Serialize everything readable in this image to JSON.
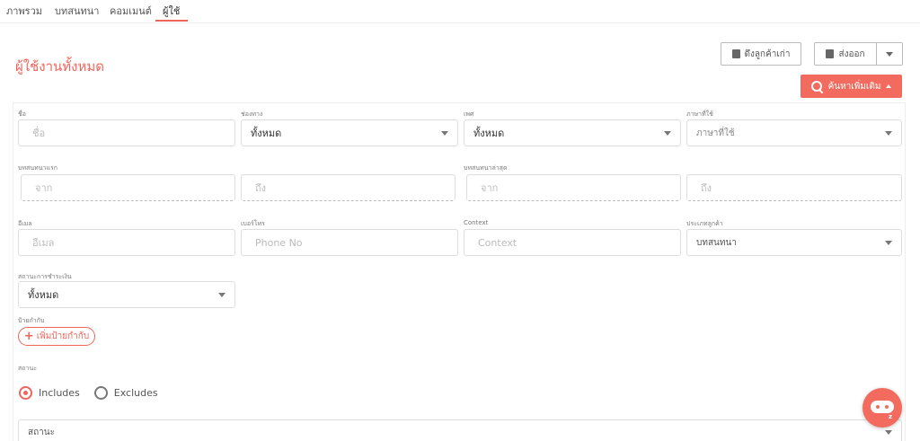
{
  "tabs": [
    {
      "label": "ภาพรวม",
      "active": false
    },
    {
      "label": "บทสนทนา",
      "active": false
    },
    {
      "label": "คอมเมนต์",
      "active": false
    },
    {
      "label": "ผู้ใช้",
      "active": true
    }
  ],
  "page": {
    "title": "ผู้ใช้งานทั้งหมด"
  },
  "toolbar": {
    "import_label": "ดึงลูกค้าเก่า",
    "export_label": "ส่งออก",
    "search_more_label": "ค้นหาเพิ่มเติม"
  },
  "filters": {
    "name": {
      "label": "ชื่อ",
      "placeholder": "ชื่อ"
    },
    "channel": {
      "label": "ช่องทาง",
      "value": "ทั้งหมด"
    },
    "gender": {
      "label": "เพศ",
      "value": "ทั้งหมด"
    },
    "language": {
      "label": "ภาษาที่ใช้",
      "value": "ภาษาที่ใช้"
    },
    "first_chat": {
      "label": "บทสนทนาแรก",
      "from": "จาก",
      "to": "ถึง"
    },
    "last_chat": {
      "label": "บทสนทนาล่าสุด",
      "from": "จาก",
      "to": "ถึง"
    },
    "email": {
      "label": "อีเมล",
      "placeholder": "อีเมล"
    },
    "phone": {
      "label": "เบอร์โทร",
      "placeholder": "Phone No"
    },
    "context": {
      "label": "Context",
      "placeholder": "Context"
    },
    "customer_type": {
      "label": "ประเภทลูกค้า",
      "value": "บทสนทนา"
    },
    "payment_status": {
      "label": "สถานะการชำระเงิน",
      "value": "ทั้งหมด"
    },
    "tags": {
      "label": "ป้ายกำกับ",
      "add_label": "เพิ่มป้ายกำกับ"
    },
    "status": {
      "label": "สถานะ",
      "includes": "Includes",
      "excludes": "Excludes",
      "selected": "includes",
      "select_placeholder": "สถานะ"
    }
  },
  "colors": {
    "accent": "#f36b5e",
    "title": "#f0645a"
  }
}
